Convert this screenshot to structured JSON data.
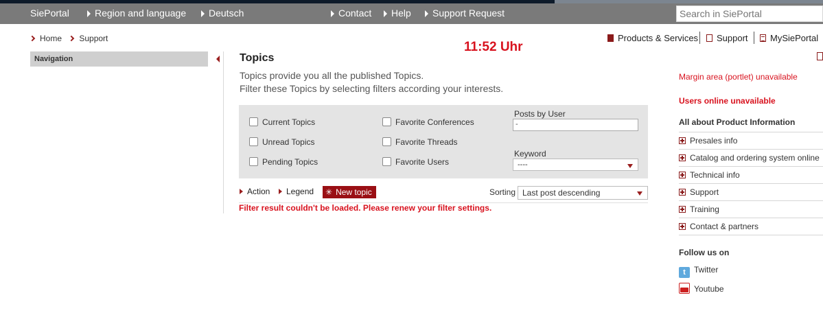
{
  "topnav": {
    "brand": "SiePortal",
    "region": "Region and language",
    "language": "Deutsch",
    "contact": "Contact",
    "help": "Help",
    "support_request": "Support Request",
    "search_placeholder": "Search in SiePortal"
  },
  "breadcrumb": [
    "Home",
    "Support"
  ],
  "toplinks": {
    "products": "Products & Services",
    "support": "Support",
    "mysieportal": "MySiePortal"
  },
  "clock": "11:52 Uhr",
  "leftnav": {
    "title": "Navigation"
  },
  "topics": {
    "title": "Topics",
    "desc_line1": "Topics provide you all the published Topics.",
    "desc_line2": "Filter these Topics by selecting filters according your interests."
  },
  "filters": {
    "current": "Current Topics",
    "unread": "Unread Topics",
    "pending": "Pending Topics",
    "fav_conferences": "Favorite Conferences",
    "fav_threads": "Favorite Threads",
    "fav_users": "Favorite Users",
    "posts_by_user_label": "Posts by User",
    "posts_by_user_value": "-",
    "keyword_label": "Keyword",
    "keyword_value": "----"
  },
  "actions": {
    "action": "Action",
    "legend": "Legend",
    "new_topic": "New topic",
    "sorting_label": "Sorting",
    "sorting_value": "Last post descending"
  },
  "error": "Filter result couldn't be loaded. Please renew your filter settings.",
  "right": {
    "margin_unavailable": "Margin area (portlet) unavailable",
    "users_online": "Users online unavailable",
    "product_info_title": "All about Product Information",
    "product_info_items": [
      "Presales info",
      "Catalog and ordering system online",
      "Technical info",
      "Support",
      "Training",
      "Contact & partners"
    ],
    "follow_title": "Follow us on",
    "twitter": "Twitter",
    "youtube": "Youtube"
  },
  "colors": {
    "accent_red": "#d8121e",
    "dark_red": "#9a0f14",
    "navbar_gray": "#7a7a7a"
  }
}
